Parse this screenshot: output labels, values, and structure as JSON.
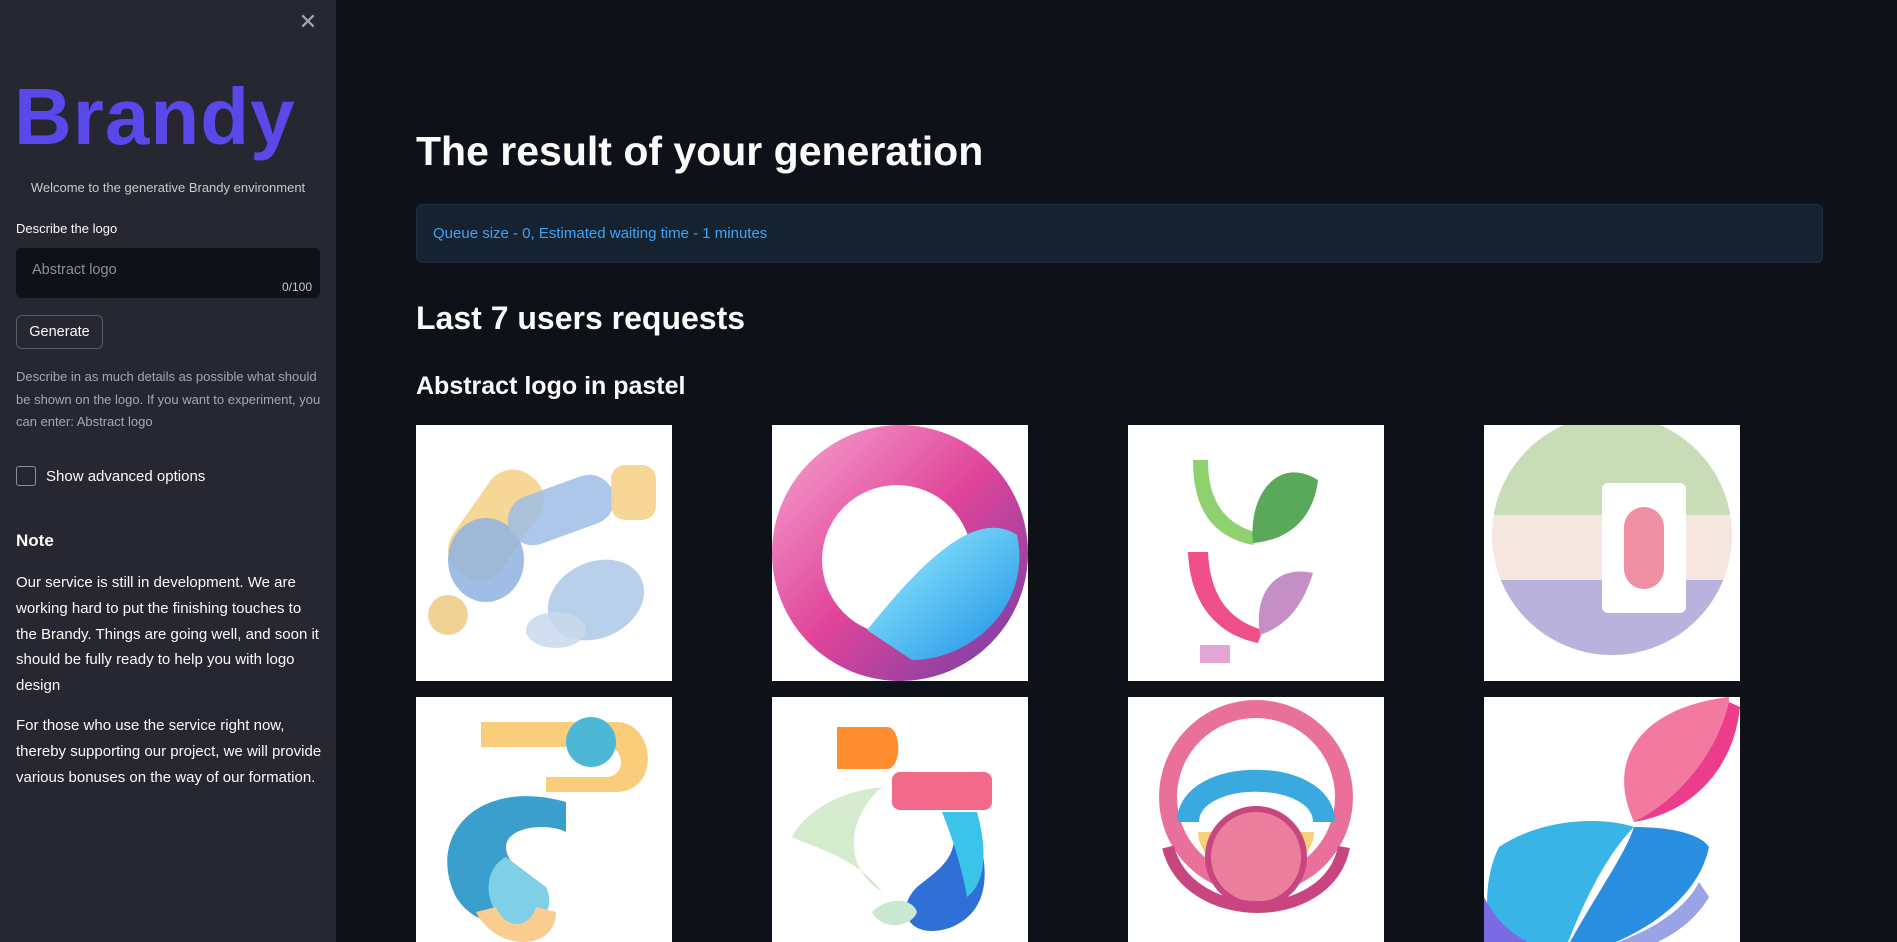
{
  "sidebar": {
    "brand": "Brandy",
    "welcome": "Welcome to the generative Brandy environment",
    "describe_label": "Describe the logo",
    "input_placeholder": "Abstract logo",
    "input_value": "",
    "char_counter": "0/100",
    "generate_label": "Generate",
    "help_text": "Describe in as much details as possible what should be shown on the logo. If you want to experiment, you can enter: Abstract logo",
    "advanced_label": "Show advanced options",
    "note_title": "Note",
    "note_p1": "Our service is still in development. We are working hard to put the finishing touches to the Brandy. Things are going well, and soon it should be fully ready to help you with logo design",
    "note_p2": "For those who use the service right now, thereby supporting our project, we will provide various bonuses on the way of our formation."
  },
  "main": {
    "title": "The result of your generation",
    "queue_info": "Queue size - 0, Estimated waiting time - 1 minutes",
    "requests_heading": "Last 7 users requests",
    "group_title": "Abstract logo in pastel"
  },
  "colors": {
    "background": "#0e1117",
    "sidebar": "#262730",
    "brand": "#5a48ea",
    "info_bg": "#172231",
    "info_text": "#3fa3f4"
  },
  "images": [
    {
      "name": "abstract-pastel-blobs-image"
    },
    {
      "name": "pink-cyan-ring-image"
    },
    {
      "name": "green-pink-leaves-image"
    },
    {
      "name": "pastel-circle-segments-image"
    },
    {
      "name": "blue-yellow-swirl-image"
    },
    {
      "name": "orange-pink-blocks-image"
    },
    {
      "name": "pink-concentric-rings-image"
    },
    {
      "name": "pink-blue-bowtie-image"
    }
  ]
}
